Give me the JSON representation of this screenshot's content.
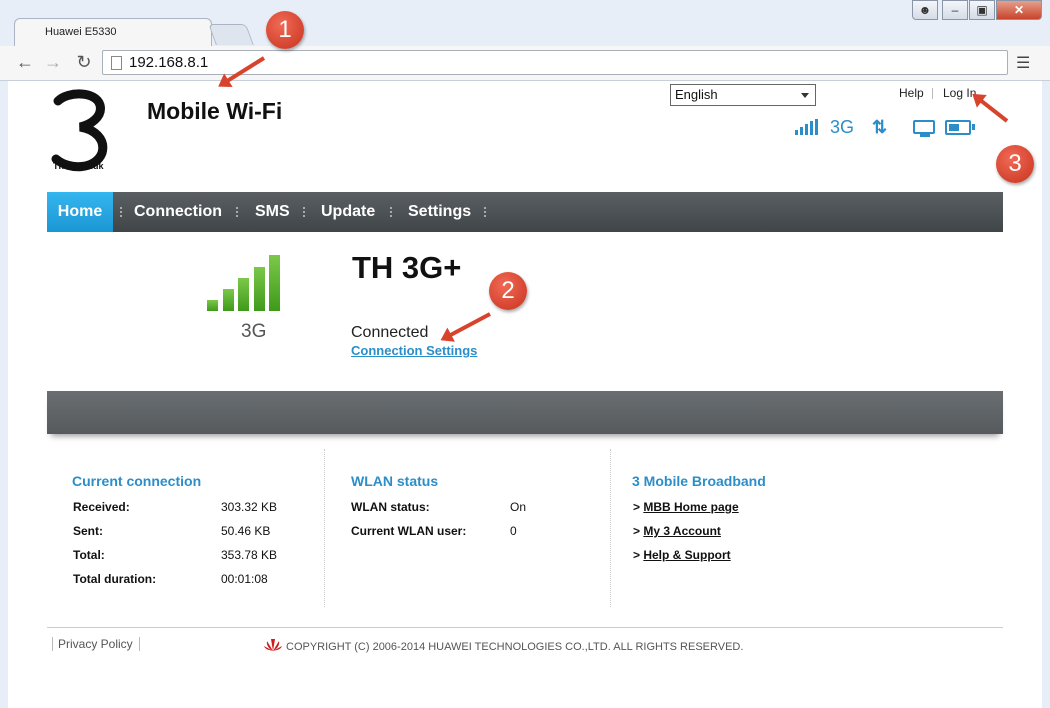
{
  "browser": {
    "tab_title": "Huawei E5330",
    "url": "192.168.8.1"
  },
  "header": {
    "logo_text": "Three.co.uk",
    "title": "Mobile Wi-Fi",
    "language": "English",
    "help": "Help",
    "login": "Log In",
    "network_type": "3G"
  },
  "nav": {
    "items": [
      "Home",
      "Connection",
      "SMS",
      "Update",
      "Settings"
    ],
    "active": "Home"
  },
  "status": {
    "signal_label": "3G",
    "operator": "TH 3G+",
    "connection_status": "Connected",
    "connection_settings": "Connection Settings"
  },
  "current_connection": {
    "title": "Current connection",
    "rows": [
      {
        "label": "Received:",
        "value": "303.32 KB"
      },
      {
        "label": "Sent:",
        "value": "50.46 KB"
      },
      {
        "label": "Total:",
        "value": "353.78 KB"
      },
      {
        "label": "Total duration:",
        "value": "00:01:08"
      }
    ]
  },
  "wlan": {
    "title": "WLAN status",
    "rows": [
      {
        "label": "WLAN status:",
        "value": "On"
      },
      {
        "label": "Current WLAN user:",
        "value": "0"
      }
    ]
  },
  "broadband": {
    "title": "3 Mobile Broadband",
    "links": [
      "MBB Home page",
      "My 3 Account",
      "Help & Support"
    ]
  },
  "footer": {
    "privacy": "Privacy Policy",
    "copyright": "COPYRIGHT (C) 2006-2014 HUAWEI TECHNOLOGIES CO.,LTD. ALL RIGHTS RESERVED."
  },
  "annotations": [
    "1",
    "2",
    "3"
  ],
  "colors": {
    "accent": "#2c8ec9",
    "nav_active": "#1b96d4",
    "signal": "#5aae2c",
    "annotation": "#d8432c"
  }
}
